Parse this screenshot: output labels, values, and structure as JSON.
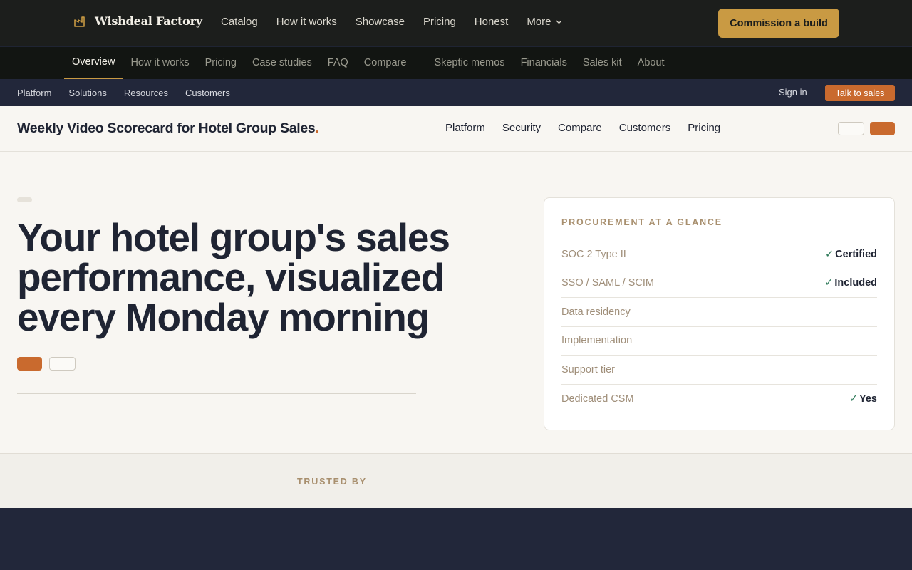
{
  "topbar": {
    "brand": "Wishdeal Factory",
    "brand_icon": "factory-icon",
    "nav": [
      "Catalog",
      "How it works",
      "Showcase",
      "Pricing",
      "Honest"
    ],
    "more_label": "More",
    "cta": "Commission a build",
    "accent": "#c99a43"
  },
  "subnav": {
    "active": "Overview",
    "primary": [
      "How it works",
      "Pricing",
      "Case studies",
      "FAQ",
      "Compare"
    ],
    "secondary": [
      "Skeptic memos",
      "Financials",
      "Sales kit",
      "About"
    ]
  },
  "utility": {
    "links": [
      "Platform",
      "Solutions",
      "Resources",
      "Customers"
    ],
    "signin": "Sign in",
    "talk": "Talk to sales"
  },
  "product": {
    "title": "Weekly Video Scorecard for Hotel Group Sales",
    "title_dot": ".",
    "nav": [
      "Platform",
      "Security",
      "Compare",
      "Customers",
      "Pricing"
    ],
    "brand_color": "#c96a2e"
  },
  "hero": {
    "headline": "Your hotel group's sales performance, visualized every Monday morning"
  },
  "procurement": {
    "title": "PROCUREMENT AT A GLANCE",
    "rows": [
      {
        "label": "SOC 2 Type II",
        "value": "Certified",
        "check": "✓"
      },
      {
        "label": "SSO / SAML / SCIM",
        "value": "Included",
        "check": "✓"
      },
      {
        "label": "Data residency",
        "value": "",
        "check": ""
      },
      {
        "label": "Implementation",
        "value": "",
        "check": ""
      },
      {
        "label": "Support tier",
        "value": "",
        "check": ""
      },
      {
        "label": "Dedicated CSM",
        "value": "Yes",
        "check": "✓"
      }
    ]
  },
  "trusted": {
    "label": "TRUSTED BY"
  }
}
